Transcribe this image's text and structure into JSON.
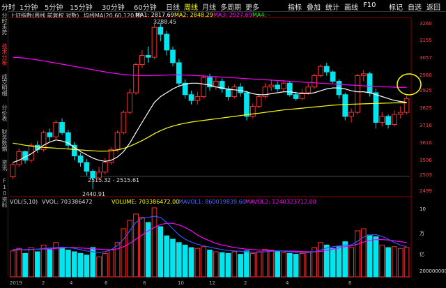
{
  "periods": [
    {
      "label": "分时",
      "active": false
    },
    {
      "label": "1分钟",
      "active": false
    },
    {
      "label": "5分钟",
      "active": false
    },
    {
      "label": "15分钟",
      "active": false
    },
    {
      "label": "30分钟",
      "active": false
    },
    {
      "label": "60分钟",
      "active": false
    },
    {
      "label": "日线",
      "active": false
    },
    {
      "label": "周线",
      "active": true
    },
    {
      "label": "月线",
      "active": false
    },
    {
      "label": "多周期",
      "active": false
    },
    {
      "label": "更多",
      "active": false
    }
  ],
  "menu": [
    "指标",
    "叠加",
    "统计",
    "画线",
    "F10",
    "标记",
    "自选",
    "返回"
  ],
  "side_tabs": [
    {
      "label": "分时走势",
      "active": false
    },
    {
      "label": "技术分析",
      "active": true
    },
    {
      "label": "成交明细",
      "active": false
    },
    {
      "label": "分价表",
      "active": false
    },
    {
      "label": "财务数据",
      "active": false
    },
    {
      "label": "资讯",
      "active": false
    },
    {
      "label": "F10资料",
      "active": false
    }
  ],
  "price_legend": {
    "title": "上证指数(周线 前复权 对数)",
    "ind": "均线MA(20,60,120,0)",
    "ma1": "MA1: 2817.69",
    "ma2": "MA2: 2848.29",
    "ma3": "MA3: 2927.69",
    "ma4": "MA4: -"
  },
  "vol_legend": {
    "title": "VOL(5,10)",
    "vvol": "VVOL: 703386472",
    "volume": "VOLUME: 703386472.00",
    "mavol1": "MAVOL1: 860019839.60",
    "mavol2": "MAVOL2: 1240323712.00"
  },
  "annotations": {
    "high": "3288.45",
    "range": "2515.32 - 2515.61",
    "low": "2440.91"
  },
  "price_axis": [
    "3260",
    "3155",
    "3057",
    "2960",
    "2925",
    "3825",
    "3716",
    "3610",
    "3506",
    "2503",
    "2499"
  ],
  "vol_axis": [
    "10",
    "万",
    "亿",
    "200000000"
  ],
  "x_ticks": [
    "2019",
    "2",
    "4",
    "6",
    "8",
    "10",
    "12",
    "2",
    "4",
    "6"
  ],
  "colors": {
    "up": "#ff3030",
    "down": "#00e5ee",
    "ma1": "#ffffff",
    "ma2": "#ffff00",
    "ma3": "#ff00ff",
    "ma4": "#00ff00",
    "highlight": "#ffff00"
  },
  "chart_data": {
    "type": "candlestick",
    "interval": "weekly",
    "candles": [
      {
        "o": 2495,
        "c": 2550,
        "h": 2560,
        "l": 2485
      },
      {
        "o": 2550,
        "c": 2610,
        "h": 2625,
        "l": 2540
      },
      {
        "o": 2610,
        "c": 2570,
        "h": 2615,
        "l": 2555
      },
      {
        "o": 2570,
        "c": 2640,
        "h": 2650,
        "l": 2560
      },
      {
        "o": 2640,
        "c": 2620,
        "h": 2660,
        "l": 2605
      },
      {
        "o": 2620,
        "c": 2700,
        "h": 2710,
        "l": 2610
      },
      {
        "o": 2700,
        "c": 2680,
        "h": 2720,
        "l": 2660
      },
      {
        "o": 2680,
        "c": 2750,
        "h": 2760,
        "l": 2670
      },
      {
        "o": 2750,
        "c": 2700,
        "h": 2770,
        "l": 2690
      },
      {
        "o": 2700,
        "c": 2640,
        "h": 2715,
        "l": 2620
      },
      {
        "o": 2640,
        "c": 2590,
        "h": 2655,
        "l": 2570
      },
      {
        "o": 2590,
        "c": 2560,
        "h": 2605,
        "l": 2540
      },
      {
        "o": 2560,
        "c": 2520,
        "h": 2575,
        "l": 2500
      },
      {
        "o": 2520,
        "c": 2490,
        "h": 2530,
        "l": 2440
      },
      {
        "o": 2490,
        "c": 2516,
        "h": 2540,
        "l": 2480
      },
      {
        "o": 2516,
        "c": 2560,
        "h": 2580,
        "l": 2505
      },
      {
        "o": 2560,
        "c": 2620,
        "h": 2630,
        "l": 2550
      },
      {
        "o": 2620,
        "c": 2700,
        "h": 2710,
        "l": 2610
      },
      {
        "o": 2700,
        "c": 2800,
        "h": 2810,
        "l": 2690
      },
      {
        "o": 2800,
        "c": 2900,
        "h": 2920,
        "l": 2790
      },
      {
        "o": 2900,
        "c": 3050,
        "h": 3060,
        "l": 2890
      },
      {
        "o": 3050,
        "c": 3100,
        "h": 3130,
        "l": 3030
      },
      {
        "o": 3100,
        "c": 3090,
        "h": 3150,
        "l": 3060
      },
      {
        "o": 3090,
        "c": 3260,
        "h": 3288,
        "l": 3080
      },
      {
        "o": 3260,
        "c": 3220,
        "h": 3285,
        "l": 3180
      },
      {
        "o": 3220,
        "c": 3130,
        "h": 3240,
        "l": 3100
      },
      {
        "o": 3130,
        "c": 3060,
        "h": 3150,
        "l": 3040
      },
      {
        "o": 3060,
        "c": 2950,
        "h": 3080,
        "l": 2930
      },
      {
        "o": 2950,
        "c": 2890,
        "h": 2970,
        "l": 2870
      },
      {
        "o": 2890,
        "c": 2860,
        "h": 2910,
        "l": 2840
      },
      {
        "o": 2860,
        "c": 2880,
        "h": 2905,
        "l": 2840
      },
      {
        "o": 2880,
        "c": 2980,
        "h": 2995,
        "l": 2870
      },
      {
        "o": 2980,
        "c": 2930,
        "h": 3000,
        "l": 2910
      },
      {
        "o": 2930,
        "c": 2960,
        "h": 2980,
        "l": 2915
      },
      {
        "o": 2960,
        "c": 2920,
        "h": 2975,
        "l": 2900
      },
      {
        "o": 2920,
        "c": 2880,
        "h": 2935,
        "l": 2860
      },
      {
        "o": 2880,
        "c": 2930,
        "h": 2945,
        "l": 2870
      },
      {
        "o": 2930,
        "c": 2900,
        "h": 2950,
        "l": 2880
      },
      {
        "o": 2900,
        "c": 2780,
        "h": 2910,
        "l": 2760
      },
      {
        "o": 2780,
        "c": 2830,
        "h": 2845,
        "l": 2770
      },
      {
        "o": 2830,
        "c": 2880,
        "h": 2895,
        "l": 2820
      },
      {
        "o": 2880,
        "c": 2930,
        "h": 2950,
        "l": 2870
      },
      {
        "o": 2930,
        "c": 2940,
        "h": 2970,
        "l": 2910
      },
      {
        "o": 2940,
        "c": 2920,
        "h": 2960,
        "l": 2905
      },
      {
        "o": 2920,
        "c": 2950,
        "h": 2965,
        "l": 2905
      },
      {
        "o": 2950,
        "c": 2890,
        "h": 2960,
        "l": 2880
      },
      {
        "o": 2890,
        "c": 2870,
        "h": 2905,
        "l": 2860
      },
      {
        "o": 2870,
        "c": 2900,
        "h": 2920,
        "l": 2860
      },
      {
        "o": 2900,
        "c": 2930,
        "h": 2950,
        "l": 2890
      },
      {
        "o": 2930,
        "c": 2990,
        "h": 3000,
        "l": 2920
      },
      {
        "o": 2990,
        "c": 3040,
        "h": 3050,
        "l": 2980
      },
      {
        "o": 3040,
        "c": 3010,
        "h": 3060,
        "l": 2990
      },
      {
        "o": 3010,
        "c": 2960,
        "h": 3020,
        "l": 2950
      },
      {
        "o": 2960,
        "c": 2890,
        "h": 2970,
        "l": 2870
      },
      {
        "o": 2890,
        "c": 2780,
        "h": 2900,
        "l": 2760
      },
      {
        "o": 2780,
        "c": 2800,
        "h": 2820,
        "l": 2750
      },
      {
        "o": 2800,
        "c": 2990,
        "h": 3000,
        "l": 2790
      },
      {
        "o": 2990,
        "c": 3000,
        "h": 3020,
        "l": 2960
      },
      {
        "o": 3000,
        "c": 2900,
        "h": 3010,
        "l": 2880
      },
      {
        "o": 2900,
        "c": 2750,
        "h": 2920,
        "l": 2720
      },
      {
        "o": 2750,
        "c": 2780,
        "h": 2800,
        "l": 2730
      },
      {
        "o": 2780,
        "c": 2740,
        "h": 2790,
        "l": 2720
      },
      {
        "o": 2740,
        "c": 2790,
        "h": 2810,
        "l": 2730
      },
      {
        "o": 2790,
        "c": 2800,
        "h": 2830,
        "l": 2770
      },
      {
        "o": 2800,
        "c": 2870,
        "h": 2885,
        "l": 2790
      }
    ],
    "ma1": [
      2560,
      2570,
      2585,
      2600,
      2620,
      2640,
      2655,
      2665,
      2660,
      2650,
      2630,
      2610,
      2595,
      2580,
      2570,
      2565,
      2570,
      2585,
      2610,
      2650,
      2700,
      2750,
      2800,
      2850,
      2880,
      2900,
      2920,
      2935,
      2945,
      2950,
      2950,
      2945,
      2940,
      2930,
      2925,
      2918,
      2915,
      2912,
      2905,
      2895,
      2890,
      2890,
      2895,
      2900,
      2905,
      2905,
      2900,
      2895,
      2895,
      2900,
      2910,
      2920,
      2925,
      2925,
      2920,
      2910,
      2905,
      2905,
      2900,
      2890,
      2880,
      2870,
      2860,
      2855,
      2850
    ],
    "ma2": [
      2650,
      2645,
      2640,
      2636,
      2632,
      2630,
      2628,
      2626,
      2624,
      2622,
      2620,
      2618,
      2616,
      2614,
      2612,
      2612,
      2614,
      2618,
      2625,
      2635,
      2648,
      2662,
      2678,
      2695,
      2710,
      2722,
      2732,
      2740,
      2746,
      2752,
      2756,
      2760,
      2764,
      2768,
      2772,
      2776,
      2780,
      2784,
      2788,
      2792,
      2796,
      2800,
      2804,
      2808,
      2812,
      2815,
      2818,
      2821,
      2824,
      2827,
      2830,
      2833,
      2836,
      2838,
      2840,
      2841,
      2842,
      2843,
      2844,
      2845,
      2846,
      2847,
      2848,
      2848,
      2848
    ],
    "ma3": [
      3090,
      3088,
      3085,
      3080,
      3075,
      3070,
      3064,
      3058,
      3052,
      3046,
      3040,
      3034,
      3028,
      3022,
      3016,
      3010,
      3005,
      3000,
      2996,
      2993,
      2991,
      2990,
      2990,
      2991,
      2992,
      2993,
      2994,
      2994,
      2993,
      2992,
      2990,
      2988,
      2986,
      2984,
      2982,
      2980,
      2978,
      2976,
      2974,
      2972,
      2970,
      2968,
      2966,
      2964,
      2962,
      2960,
      2958,
      2956,
      2954,
      2952,
      2950,
      2948,
      2946,
      2944,
      2942,
      2940,
      2938,
      2936,
      2934,
      2932,
      2931,
      2930,
      2929,
      2928,
      2928
    ],
    "volume": [
      620,
      680,
      560,
      700,
      600,
      760,
      650,
      820,
      700,
      640,
      600,
      560,
      520,
      700,
      480,
      560,
      640,
      820,
      1150,
      1350,
      1500,
      1420,
      1300,
      1650,
      1200,
      980,
      900,
      820,
      760,
      700,
      680,
      720,
      640,
      600,
      580,
      560,
      600,
      540,
      620,
      560,
      600,
      660,
      640,
      600,
      580,
      560,
      540,
      560,
      600,
      700,
      820,
      760,
      680,
      720,
      840,
      700,
      1100,
      1150,
      1000,
      960,
      760,
      700,
      720,
      680,
      703
    ],
    "mavol1": [
      650,
      660,
      640,
      650,
      660,
      680,
      690,
      700,
      710,
      700,
      680,
      650,
      620,
      600,
      580,
      600,
      650,
      750,
      900,
      1100,
      1300,
      1400,
      1420,
      1450,
      1420,
      1300,
      1150,
      1000,
      900,
      830,
      780,
      740,
      710,
      680,
      650,
      630,
      620,
      610,
      600,
      590,
      590,
      600,
      610,
      620,
      615,
      600,
      590,
      580,
      580,
      600,
      640,
      690,
      720,
      740,
      760,
      760,
      850,
      950,
      1000,
      1010,
      970,
      900,
      820,
      760,
      720
    ],
    "mavol2": [
      640,
      645,
      650,
      655,
      660,
      665,
      670,
      680,
      690,
      700,
      700,
      690,
      680,
      670,
      660,
      650,
      650,
      670,
      720,
      800,
      900,
      1000,
      1100,
      1180,
      1250,
      1280,
      1280,
      1240,
      1180,
      1100,
      1000,
      920,
      860,
      800,
      760,
      730,
      700,
      680,
      660,
      650,
      640,
      630,
      625,
      620,
      618,
      615,
      610,
      605,
      600,
      600,
      610,
      630,
      660,
      690,
      720,
      740,
      780,
      830,
      870,
      890,
      890,
      880,
      860,
      840,
      820
    ]
  }
}
